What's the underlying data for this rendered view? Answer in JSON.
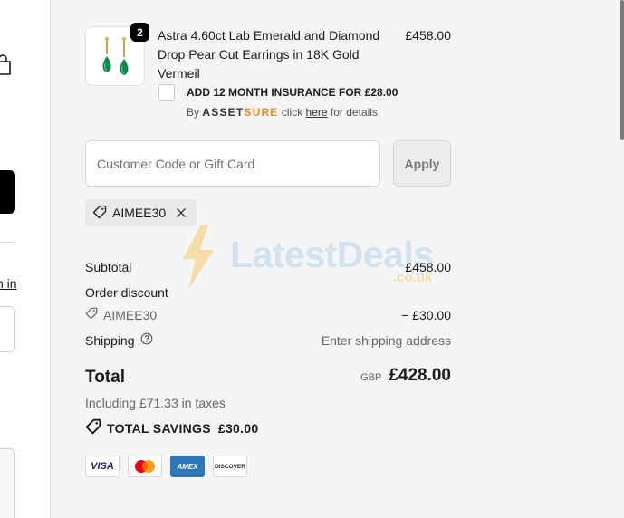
{
  "product": {
    "quantity": "2",
    "title": "Astra 4.60ct Lab Emerald and Diamond Drop Pear Cut Earrings in 18K Gold Vermeil",
    "price": "£458.00",
    "image_icon": "emerald-earrings-icon"
  },
  "insurance": {
    "label": "ADD 12 MONTH INSURANCE FOR £28.00",
    "by_prefix": "By",
    "brand_part1": "ASSET",
    "brand_part2": "SURE",
    "click_text": "click",
    "link_text": "here",
    "suffix": "for details"
  },
  "discount": {
    "placeholder": "Customer Code or Gift Card",
    "apply_label": "Apply",
    "applied_code": "AIMEE30"
  },
  "watermark": {
    "text": "LatestDeals",
    "sub": ".co.uk"
  },
  "summary": {
    "subtotal_label": "Subtotal",
    "subtotal_value": "£458.00",
    "order_discount_label": "Order discount",
    "discount_code": "AIMEE30",
    "discount_value": "− £30.00",
    "shipping_label": "Shipping",
    "shipping_value": "Enter shipping address",
    "total_label": "Total",
    "total_currency": "GBP",
    "total_value": "£428.00",
    "taxes_text": "Including £71.33 in taxes",
    "savings_label": "TOTAL SAVINGS",
    "savings_value": "£30.00"
  },
  "payment_cards": [
    "VISA",
    "Mastercard",
    "AMEX",
    "DISCOVER"
  ],
  "left_partial": {
    "link_text": "n in"
  },
  "colors": {
    "accent_orange": "#f08a1c",
    "amex_blue": "#2e77bc",
    "visa_navy": "#1a1f71"
  }
}
